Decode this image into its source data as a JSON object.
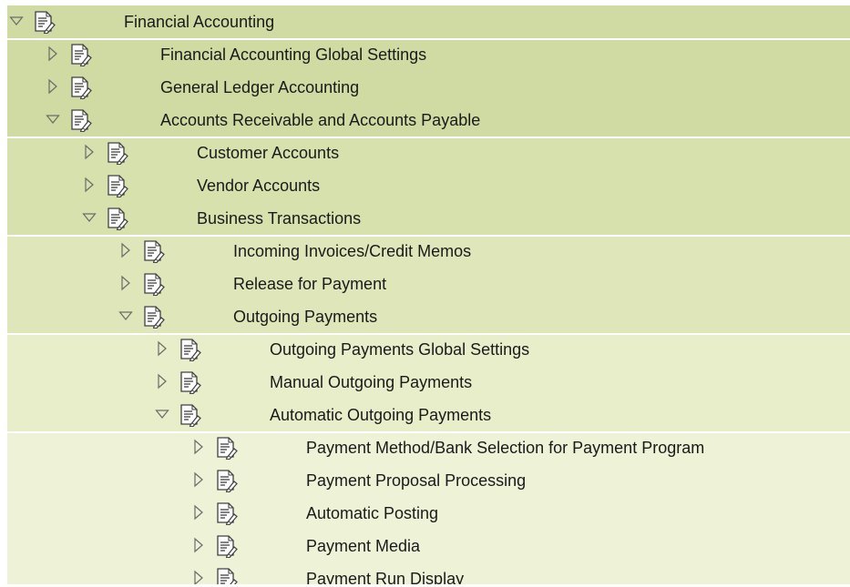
{
  "colors": {
    "level0": "#cfdba2",
    "level1": "#cfdba2",
    "level2": "#d7e1ad",
    "level3": "#dfe7ba",
    "level4": "#e8eec9",
    "level5": "#eef2d7",
    "twisty": "#6b6b6b",
    "icon_stroke": "#404040",
    "icon_fill": "#ffffff"
  },
  "tree": {
    "nodes": [
      {
        "label": "Financial Accounting",
        "level": 0,
        "expanded": true,
        "icon": "document-icon"
      },
      {
        "label": "Financial Accounting Global Settings",
        "level": 1,
        "expanded": false,
        "icon": "document-icon"
      },
      {
        "label": "General Ledger Accounting",
        "level": 1,
        "expanded": false,
        "icon": "document-icon"
      },
      {
        "label": "Accounts Receivable and Accounts Payable",
        "level": 1,
        "expanded": true,
        "icon": "document-icon"
      },
      {
        "label": "Customer Accounts",
        "level": 2,
        "expanded": false,
        "icon": "document-icon"
      },
      {
        "label": "Vendor Accounts",
        "level": 2,
        "expanded": false,
        "icon": "document-icon"
      },
      {
        "label": "Business Transactions",
        "level": 2,
        "expanded": true,
        "icon": "document-icon"
      },
      {
        "label": "Incoming Invoices/Credit Memos",
        "level": 3,
        "expanded": false,
        "icon": "document-icon"
      },
      {
        "label": "Release for Payment",
        "level": 3,
        "expanded": false,
        "icon": "document-icon"
      },
      {
        "label": "Outgoing Payments",
        "level": 3,
        "expanded": true,
        "icon": "document-icon"
      },
      {
        "label": "Outgoing Payments Global Settings",
        "level": 4,
        "expanded": false,
        "icon": "document-icon"
      },
      {
        "label": "Manual Outgoing Payments",
        "level": 4,
        "expanded": false,
        "icon": "document-icon"
      },
      {
        "label": "Automatic Outgoing Payments",
        "level": 4,
        "expanded": true,
        "icon": "document-icon"
      },
      {
        "label": "Payment Method/Bank Selection for Payment Program",
        "level": 5,
        "expanded": false,
        "icon": "document-icon"
      },
      {
        "label": "Payment Proposal Processing",
        "level": 5,
        "expanded": false,
        "icon": "document-icon"
      },
      {
        "label": "Automatic Posting",
        "level": 5,
        "expanded": false,
        "icon": "document-icon"
      },
      {
        "label": "Payment Media",
        "level": 5,
        "expanded": false,
        "icon": "document-icon"
      },
      {
        "label": "Payment Run Display",
        "level": 5,
        "expanded": false,
        "icon": "document-icon"
      }
    ]
  }
}
